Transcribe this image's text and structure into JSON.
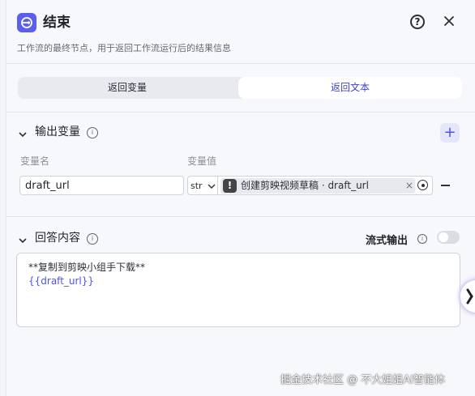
{
  "header": {
    "title": "结束",
    "description": "工作流的最终节点，用于返回工作流运行后的结果信息"
  },
  "mode_tabs": [
    {
      "label": "返回变量",
      "selected": false
    },
    {
      "label": "返回文本",
      "selected": true
    }
  ],
  "output_section": {
    "title": "输出变量",
    "col_name": "变量名",
    "col_value": "变量值",
    "rows": [
      {
        "name": "draft_url",
        "type": "str",
        "value_ref": "创建剪映视频草稿 · draft_url"
      }
    ]
  },
  "answer_section": {
    "title": "回答内容",
    "stream_label": "流式输出",
    "stream_enabled": false,
    "content_line1": "**复制到剪映小组手下载**",
    "content_line2": "{{draft_url}}"
  },
  "watermark": "掘金技术社区 @ 不大姐姐AI智能体",
  "colors": {
    "accent": "#5b5ff0",
    "variable_text": "#4d53e6"
  }
}
